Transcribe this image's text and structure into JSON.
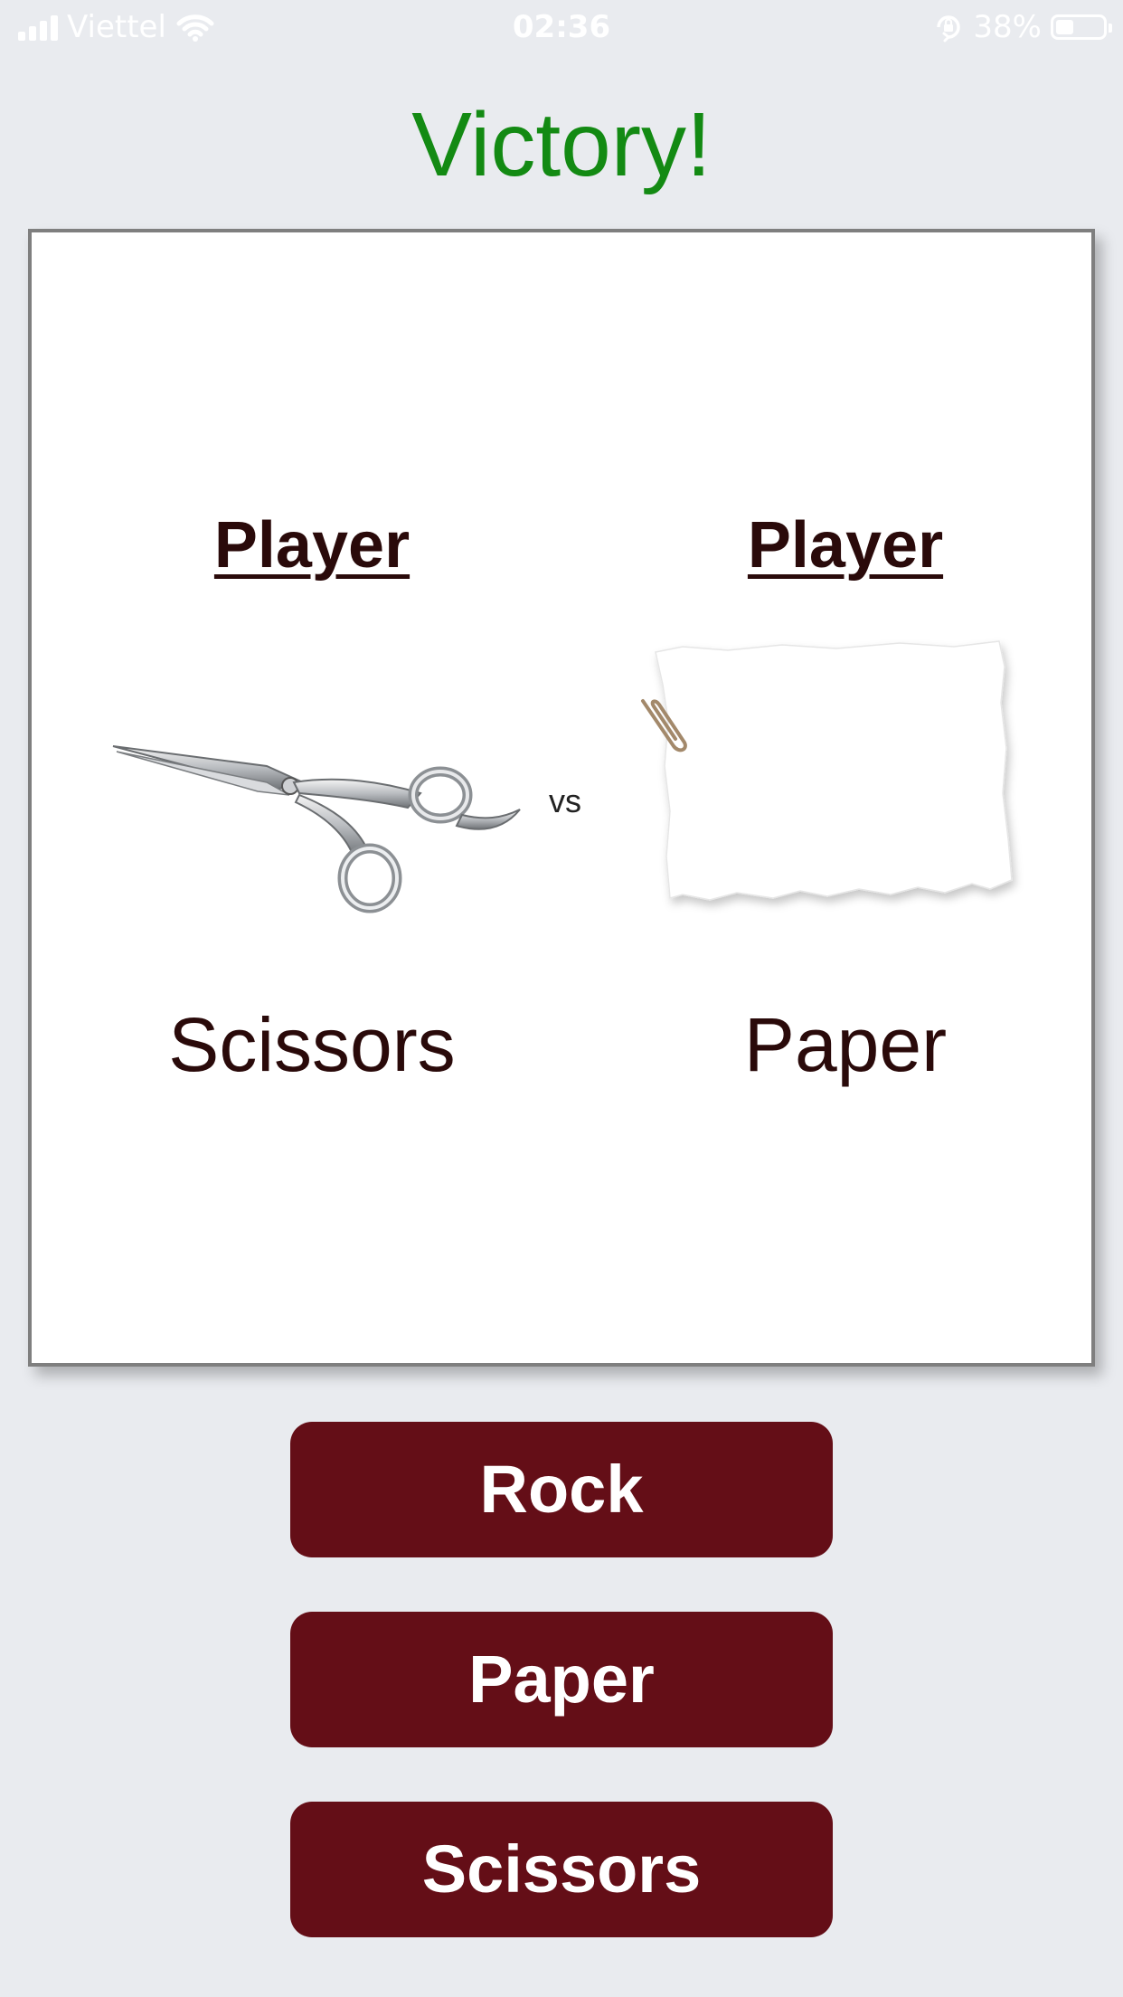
{
  "status_bar": {
    "carrier": "Viettel",
    "time": "02:36",
    "battery_percent_label": "38%",
    "battery_level": 0.38,
    "signal_bars": 4,
    "icons": [
      "signal-icon",
      "wifi-icon",
      "orientation-lock-icon",
      "battery-icon"
    ]
  },
  "result": {
    "title": "Victory!",
    "color": "#138a13"
  },
  "arena": {
    "left": {
      "player_label": "Player",
      "choice": "Scissors",
      "image": "scissors-image"
    },
    "vs_label": "vs",
    "right": {
      "player_label": "Player",
      "choice": "Paper",
      "image": "paper-image"
    }
  },
  "buttons": {
    "rock": "Rock",
    "paper": "Paper",
    "scissors": "Scissors",
    "color": "#640e17"
  }
}
